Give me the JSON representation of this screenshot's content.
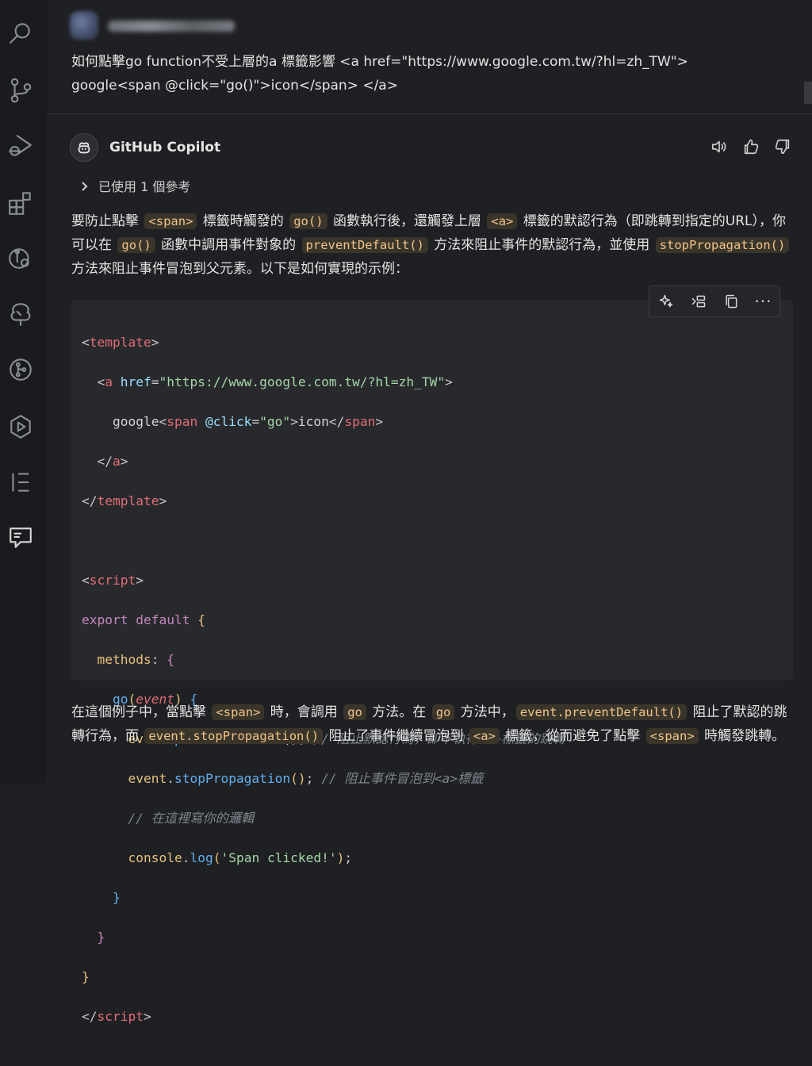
{
  "user": {
    "question_line1": "如何點擊go function不受上層的a 標籤影響 <a href=\"https://www.google.com.tw/?hl=zh_TW\">",
    "question_line2": "google<span @click=\"go()\">icon</span> </a>"
  },
  "copilot": {
    "name": "GitHub Copilot",
    "references_label": "已使用 1 個參考"
  },
  "intro": {
    "t1": "要防止點擊 ",
    "c1": "<span>",
    "t2": " 標籤時觸發的 ",
    "c2": "go()",
    "t3": " 函數執行後，還觸發上層 ",
    "c3": "<a>",
    "t4": " 標籤的默認行為（即跳轉到指定的URL），你可以在 ",
    "c4": "go()",
    "t5": " 函數中調用事件對象的 ",
    "c5": "preventDefault()",
    "t6": " 方法來阻止事件的默認行為，並使用 ",
    "c6": "stopPropagation()",
    "t7": " 方法來阻止事件冒泡到父元素。以下是如何實現的示例："
  },
  "code": {
    "template_open": "template",
    "a_tag": "a",
    "href_attr": "href",
    "href_val": "\"https://www.google.com.tw/?hl=zh_TW\"",
    "google_text": "google",
    "span_tag": "span",
    "click_attr": "@click",
    "click_val": "\"go\"",
    "icon_text": "icon",
    "script_tag": "script",
    "export_kw": "export",
    "default_kw": "default",
    "methods_prop": "methods",
    "go_fn": "go",
    "event_param": "event",
    "event_obj": "event",
    "prevent_fn": "preventDefault",
    "comment1": "// 阻止默認行為，即不執行<a>標籤的跳轉",
    "stop_fn": "stopPropagation",
    "comment2": "// 阻止事件冒泡到<a>標籤",
    "comment3": "// 在這裡寫你的邏輯",
    "console_obj": "console",
    "log_fn": "log",
    "log_str": "'Span clicked!'"
  },
  "outro": {
    "t1": "在這個例子中，當點擊 ",
    "c1": "<span>",
    "t2": " 時，會調用 ",
    "c2": "go",
    "t3": " 方法。在 ",
    "c3": "go",
    "t4": " 方法中，",
    "c4": "event.preventDefault()",
    "t5": " 阻止了默認的跳轉行為，而 ",
    "c5": "event.stopPropagation()",
    "t6": " 阻止了事件繼續冒泡到 ",
    "c6": "<a>",
    "t7": " 標籤，從而避免了點擊 ",
    "c7": "<span>",
    "t8": " 時觸發跳轉。"
  },
  "icons": {
    "activity": [
      "search-icon",
      "source-control-icon",
      "run-debug-icon",
      "extensions-icon",
      "remote-explorer-icon",
      "tree-icon",
      "git-graph-icon",
      "play-circle-icon",
      "elementor-icon",
      "chat-icon"
    ],
    "header": [
      "speaker-icon",
      "thumbs-up-icon",
      "thumbs-down-icon"
    ],
    "toolbar": [
      "sparkle-icon",
      "insert-icon",
      "copy-icon",
      "more-icon"
    ]
  }
}
